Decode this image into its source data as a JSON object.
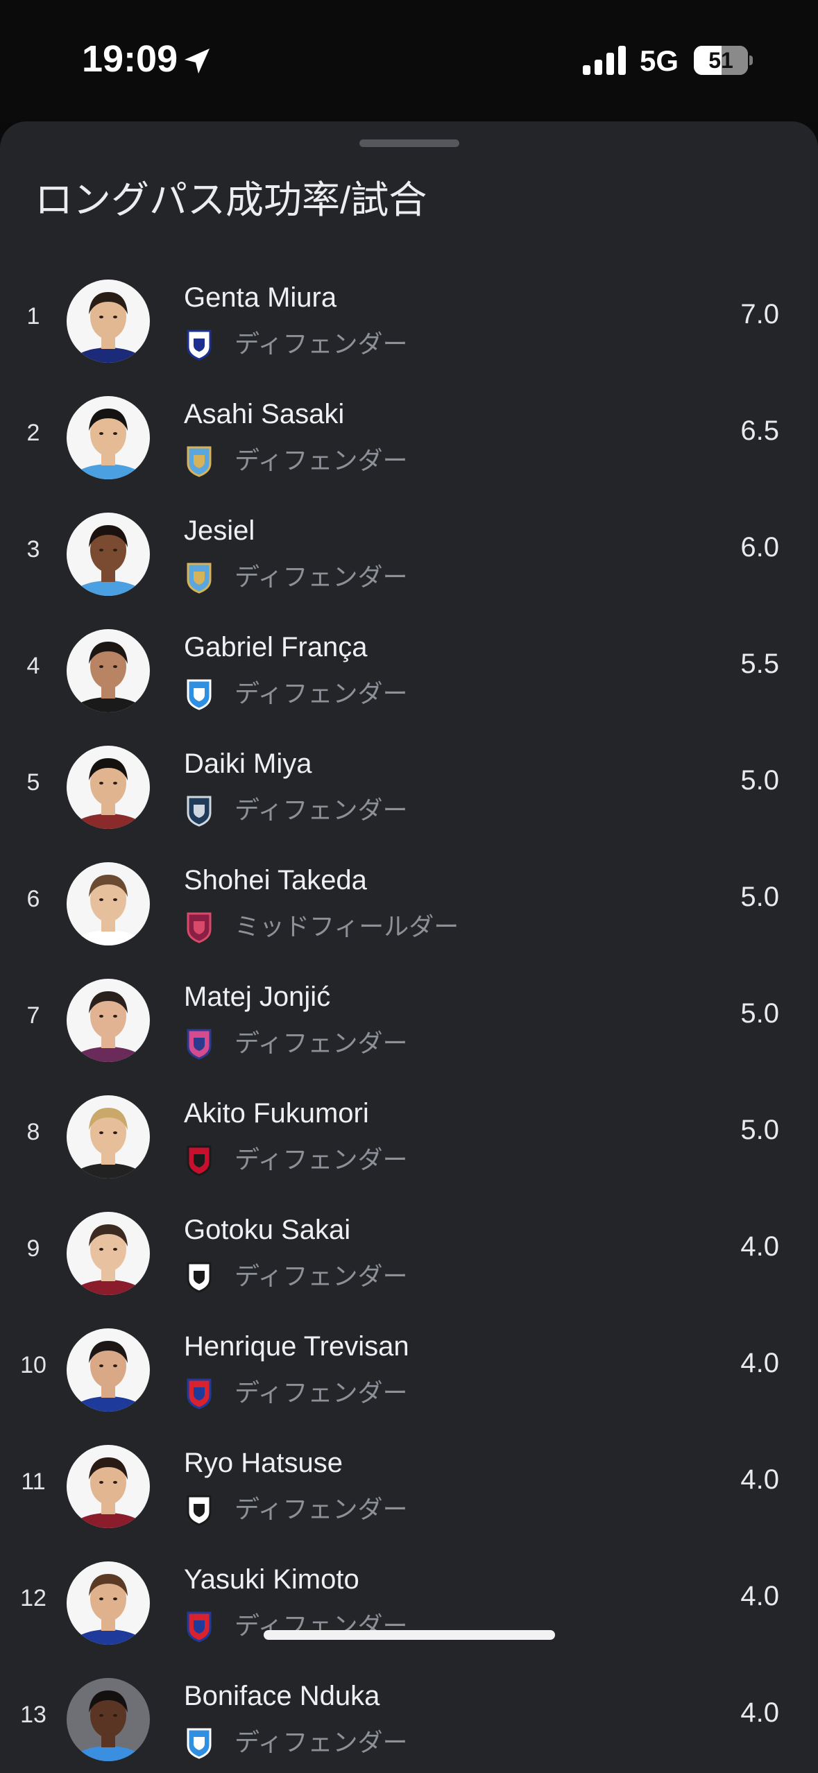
{
  "status_bar": {
    "time": "19:09",
    "location_icon": "location-arrow-icon",
    "signal_icon": "cellular-signal-icon",
    "network": "5G",
    "battery_level": 51,
    "battery_text": "51"
  },
  "sheet": {
    "title": "ロングパス成功率/試合"
  },
  "colors": {
    "background": "#0a0a0b",
    "sheet": "#242529",
    "secondary_text": "#8d9097"
  },
  "rows": [
    {
      "rank": "1",
      "name": "Genta Miura",
      "position": "ディフェンダー",
      "value": "7.0",
      "club_icon": "gamba-osaka-badge-icon",
      "badge_colors": [
        "#ffffff",
        "#1d2f8f"
      ],
      "skin": "#e2b892",
      "hair": "#2a1d15",
      "shirt": "#1c2a7a"
    },
    {
      "rank": "2",
      "name": "Asahi Sasaki",
      "position": "ディフェンダー",
      "value": "6.5",
      "club_icon": "kawasaki-frontale-badge-icon",
      "badge_colors": [
        "#5aa7e0",
        "#d6b25a"
      ],
      "skin": "#e4bb94",
      "hair": "#151312",
      "shirt": "#4aa0e0"
    },
    {
      "rank": "3",
      "name": "Jesiel",
      "position": "ディフェンダー",
      "value": "6.0",
      "club_icon": "kawasaki-frontale-badge-icon",
      "badge_colors": [
        "#5aa7e0",
        "#d6b25a"
      ],
      "skin": "#7a4b30",
      "hair": "#1b1210",
      "shirt": "#4aa0e0"
    },
    {
      "rank": "4",
      "name": "Gabriel França",
      "position": "ディフェンダー",
      "value": "5.5",
      "club_icon": "yokohama-fc-badge-icon",
      "badge_colors": [
        "#2f8fe0",
        "#ffffff"
      ],
      "skin": "#b88463",
      "hair": "#1d1714",
      "shirt": "#1a1a1a"
    },
    {
      "rank": "5",
      "name": "Daiki Miya",
      "position": "ディフェンダー",
      "value": "5.0",
      "club_icon": "avispa-fukuoka-badge-icon",
      "badge_colors": [
        "#1f3d5a",
        "#cfd8e0"
      ],
      "skin": "#e0b48e",
      "hair": "#15110f",
      "shirt": "#8a2a2a"
    },
    {
      "rank": "6",
      "name": "Shohei Takeda",
      "position": "ミッドフィールダー",
      "value": "5.0",
      "club_icon": "kyoto-sanga-badge-icon",
      "badge_colors": [
        "#8a1f45",
        "#d94a6a"
      ],
      "skin": "#e6c09c",
      "hair": "#6a4a30",
      "shirt": "#ffffff"
    },
    {
      "rank": "7",
      "name": "Matej Jonjić",
      "position": "ディフェンダー",
      "value": "5.0",
      "club_icon": "cerezo-osaka-badge-icon",
      "badge_colors": [
        "#d64a8e",
        "#2a3a8f"
      ],
      "skin": "#e1b393",
      "hair": "#2a211c",
      "shirt": "#6a2a5a"
    },
    {
      "rank": "8",
      "name": "Akito Fukumori",
      "position": "ディフェンダー",
      "value": "5.0",
      "club_icon": "consadole-sapporo-badge-icon",
      "badge_colors": [
        "#c8102e",
        "#1a1a1a"
      ],
      "skin": "#e6bf9a",
      "hair": "#c9a86a",
      "shirt": "#222222"
    },
    {
      "rank": "9",
      "name": "Gotoku Sakai",
      "position": "ディフェンダー",
      "value": "4.0",
      "club_icon": "vissel-kobe-badge-icon",
      "badge_colors": [
        "#ffffff",
        "#1a1a1a"
      ],
      "skin": "#e8c2a0",
      "hair": "#3a2a20",
      "shirt": "#8a1c2c"
    },
    {
      "rank": "10",
      "name": "Henrique Trevisan",
      "position": "ディフェンダー",
      "value": "4.0",
      "club_icon": "fc-tokyo-badge-icon",
      "badge_colors": [
        "#d8222e",
        "#1e3a9a"
      ],
      "skin": "#d9a887",
      "hair": "#1c1714",
      "shirt": "#1e3a9a"
    },
    {
      "rank": "11",
      "name": "Ryo Hatsuse",
      "position": "ディフェンダー",
      "value": "4.0",
      "club_icon": "vissel-kobe-badge-icon",
      "badge_colors": [
        "#ffffff",
        "#1a1a1a"
      ],
      "skin": "#e2b690",
      "hair": "#2a1c14",
      "shirt": "#8a1c2c"
    },
    {
      "rank": "12",
      "name": "Yasuki Kimoto",
      "position": "ディフェンダー",
      "value": "4.0",
      "club_icon": "fc-tokyo-badge-icon",
      "badge_colors": [
        "#d8222e",
        "#1e3a9a"
      ],
      "skin": "#dfb18c",
      "hair": "#5a3a24",
      "shirt": "#1e3a9a"
    },
    {
      "rank": "13",
      "name": "Boniface Nduka",
      "position": "ディフェンダー",
      "value": "4.0",
      "club_icon": "yokohama-fc-badge-icon",
      "badge_colors": [
        "#2f8fe0",
        "#ffffff"
      ],
      "skin": "#5a3524",
      "hair": "#141010",
      "shirt": "#3a8fe0",
      "avatar_bg": "#6e7076"
    }
  ]
}
